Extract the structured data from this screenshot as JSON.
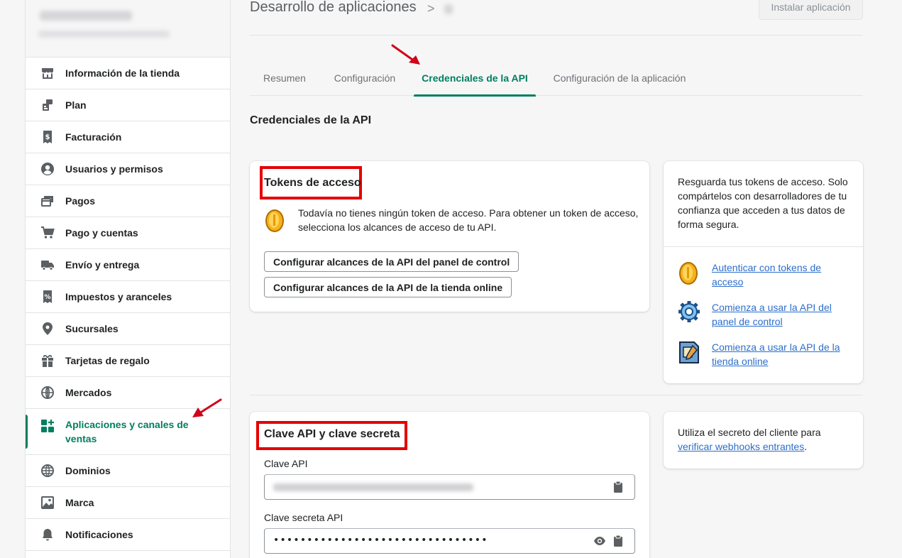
{
  "sidebar": {
    "items": [
      {
        "label": "Información de la tienda",
        "icon": "store-icon"
      },
      {
        "label": "Plan",
        "icon": "plan-icon"
      },
      {
        "label": "Facturación",
        "icon": "billing-icon"
      },
      {
        "label": "Usuarios y permisos",
        "icon": "user-icon"
      },
      {
        "label": "Pagos",
        "icon": "payments-icon"
      },
      {
        "label": "Pago y cuentas",
        "icon": "cart-icon"
      },
      {
        "label": "Envío y entrega",
        "icon": "truck-icon"
      },
      {
        "label": "Impuestos y aranceles",
        "icon": "tax-icon"
      },
      {
        "label": "Sucursales",
        "icon": "location-icon"
      },
      {
        "label": "Tarjetas de regalo",
        "icon": "gift-icon"
      },
      {
        "label": "Mercados",
        "icon": "globe-markets-icon"
      },
      {
        "label": "Aplicaciones y canales de ventas",
        "icon": "apps-icon",
        "active": true
      },
      {
        "label": "Dominios",
        "icon": "domains-icon"
      },
      {
        "label": "Marca",
        "icon": "brand-icon"
      },
      {
        "label": "Notificaciones",
        "icon": "bell-icon"
      }
    ]
  },
  "header": {
    "title": "Desarrollo de aplicaciones",
    "separator": ">",
    "install_button": "Instalar aplicación"
  },
  "tabs": [
    {
      "label": "Resumen"
    },
    {
      "label": "Configuración"
    },
    {
      "label": "Credenciales de la API",
      "active": true
    },
    {
      "label": "Configuración de la aplicación"
    }
  ],
  "section_title": "Credenciales de la API",
  "tokens_card": {
    "title": "Tokens de acceso",
    "message": "Todavía no tienes ningún token de acceso. Para obtener un token de acceso, selecciona los alcances de acceso de tu API.",
    "button_admin": "Configurar alcances de la API del panel de control",
    "button_storefront": "Configurar alcances de la API de la tienda online"
  },
  "tokens_aside": {
    "text": "Resguarda tus tokens de acceso. Solo compártelos con desarrolladores de tu confianza que acceden a tus datos de forma segura.",
    "links": [
      {
        "label": "Autenticar con tokens de acceso",
        "icon": "coin-icon"
      },
      {
        "label": "Comienza a usar la API del panel de control",
        "icon": "gear-icon"
      },
      {
        "label": "Comienza a usar la API de la tienda online",
        "icon": "storefront-doc-icon"
      }
    ]
  },
  "api_card": {
    "title": "Clave API y clave secreta",
    "api_key_label": "Clave API",
    "secret_label": "Clave secreta API",
    "secret_value": "••••••••••••••••••••••••••••••••"
  },
  "secret_aside": {
    "text_prefix": "Utiliza el secreto del cliente para",
    "link": "verificar webhooks entrantes",
    "text_suffix": "."
  },
  "colors": {
    "accent": "#007f5f",
    "link": "#2c6ecb",
    "annotation": "#e50000"
  }
}
